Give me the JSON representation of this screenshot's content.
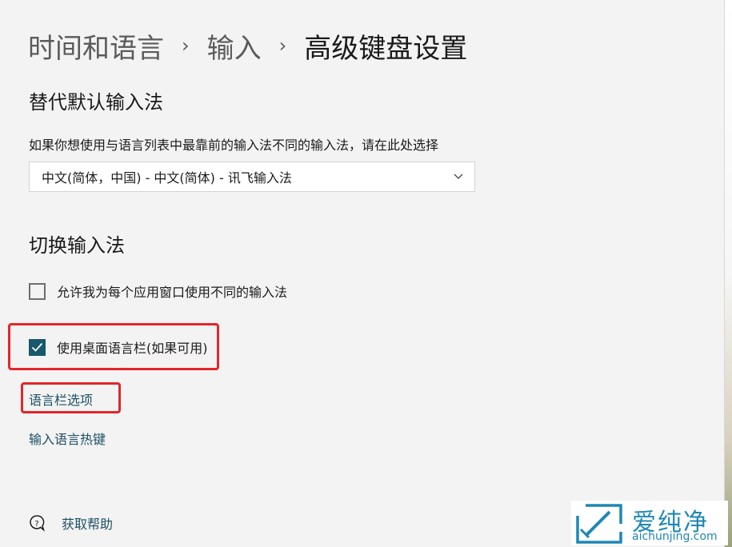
{
  "breadcrumb": {
    "items": [
      "时间和语言",
      "输入"
    ],
    "separator": "›",
    "current": "高级键盘设置"
  },
  "override_section": {
    "heading": "替代默认输入法",
    "description": "如果你想使用与语言列表中最靠前的输入法不同的输入法，请在此处选择",
    "dropdown_value": "中文(简体，中国) - 中文(简体) - 讯飞输入法"
  },
  "switch_section": {
    "heading": "切换输入法",
    "checkboxes": [
      {
        "label": "允许我为每个应用窗口使用不同的输入法",
        "checked": false
      },
      {
        "label": "使用桌面语言栏(如果可用)",
        "checked": true
      }
    ],
    "links": [
      "语言栏选项",
      "输入语言热键"
    ]
  },
  "help": {
    "label": "获取帮助",
    "icon": "help-chat-icon"
  },
  "watermark": {
    "title": "爱纯净",
    "url": "aichunjing.com"
  },
  "colors": {
    "background": "#f3f3f3",
    "checkbox_checked": "#17586c",
    "link": "#1c4f63",
    "highlight": "#e2262b",
    "watermark": "#1e87b5"
  }
}
